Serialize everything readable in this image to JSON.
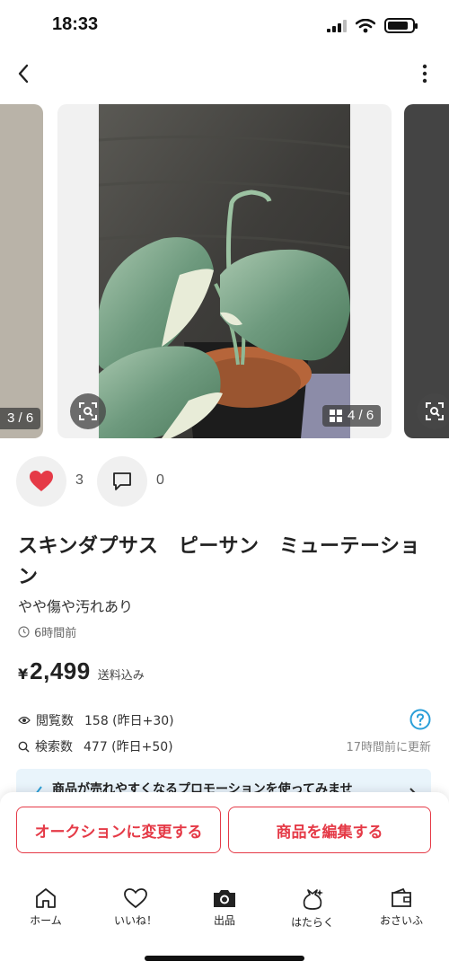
{
  "status_bar": {
    "time": "18:33",
    "battery_level": 0.85
  },
  "carousel": {
    "prev_counter": "3 / 6",
    "current_counter": "4 / 6",
    "photo_subject": "Scindapsus plant in pot"
  },
  "engagement": {
    "likes": "3",
    "comments": "0",
    "like_color": "#e53a47"
  },
  "item": {
    "title": "スキンダプサス　ピーサン　ミューテーション",
    "condition": "やや傷や汚れあり",
    "posted": "6時間前",
    "price_currency": "¥",
    "price": "2,499",
    "shipping": "送料込み"
  },
  "stats": {
    "views_label": "閲覧数",
    "views_value": "158 (昨日+30)",
    "searches_label": "検索数",
    "searches_value": "477 (昨日+50)",
    "updated": "17時間前に更新"
  },
  "promo": {
    "text": "商品が売れやすくなるプロモーションを使ってみませ"
  },
  "buttons": {
    "auction": "オークションに変更する",
    "edit": "商品を編集する",
    "accent_color": "#e53a47"
  },
  "tabs": [
    {
      "label": "ホーム",
      "icon": "home-icon"
    },
    {
      "label": "いいね！",
      "icon": "heart-outline-icon"
    },
    {
      "label": "出品",
      "icon": "camera-icon"
    },
    {
      "label": "はたらく",
      "icon": "money-bag-icon"
    },
    {
      "label": "おさいふ",
      "icon": "wallet-icon"
    }
  ]
}
